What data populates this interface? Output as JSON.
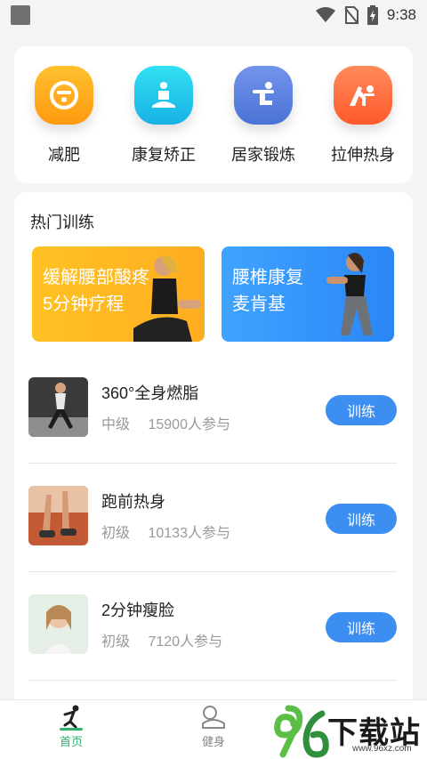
{
  "status": {
    "time": "9:38"
  },
  "categories": [
    {
      "label": "减肥",
      "icon": "scale-icon",
      "color": "#ffab1a"
    },
    {
      "label": "康复矫正",
      "icon": "meditation-icon",
      "color": "#20c7e8"
    },
    {
      "label": "居家锻炼",
      "icon": "stretch-figure-icon",
      "color": "#5b84e0"
    },
    {
      "label": "拉伸热身",
      "icon": "yoga-pose-icon",
      "color": "#ff6a3d"
    }
  ],
  "hot": {
    "title": "热门训练",
    "banners": [
      {
        "line1": "缓解腰部酸疼",
        "line2": "5分钟疗程"
      },
      {
        "line1": "腰椎康复",
        "line2": "麦肯基"
      }
    ],
    "courses": [
      {
        "name": "360°全身燃脂",
        "level": "中级",
        "participants": "15900人参与",
        "button": "训练"
      },
      {
        "name": "跑前热身",
        "level": "初级",
        "participants": "10133人参与",
        "button": "训练"
      },
      {
        "name": "2分钟瘦脸",
        "level": "初级",
        "participants": "7120人参与",
        "button": "训练"
      }
    ]
  },
  "nav": {
    "home_label": "首页",
    "fitness_label": "健身"
  },
  "watermark": {
    "text": "下载站",
    "url": "www.96xz.com"
  }
}
